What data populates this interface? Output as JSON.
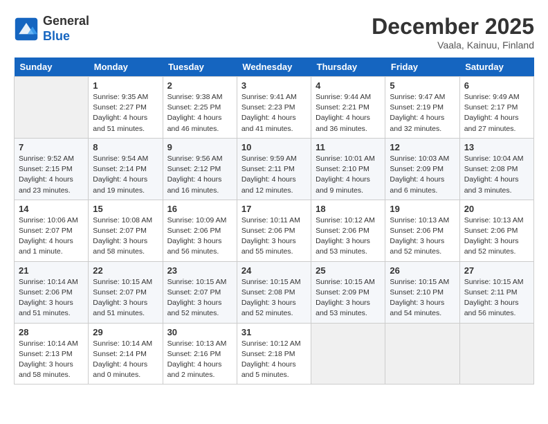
{
  "header": {
    "logo_general": "General",
    "logo_blue": "Blue",
    "month_year": "December 2025",
    "location": "Vaala, Kainuu, Finland"
  },
  "days_of_week": [
    "Sunday",
    "Monday",
    "Tuesday",
    "Wednesday",
    "Thursday",
    "Friday",
    "Saturday"
  ],
  "weeks": [
    [
      {
        "day": "",
        "info": ""
      },
      {
        "day": "1",
        "info": "Sunrise: 9:35 AM\nSunset: 2:27 PM\nDaylight: 4 hours\nand 51 minutes."
      },
      {
        "day": "2",
        "info": "Sunrise: 9:38 AM\nSunset: 2:25 PM\nDaylight: 4 hours\nand 46 minutes."
      },
      {
        "day": "3",
        "info": "Sunrise: 9:41 AM\nSunset: 2:23 PM\nDaylight: 4 hours\nand 41 minutes."
      },
      {
        "day": "4",
        "info": "Sunrise: 9:44 AM\nSunset: 2:21 PM\nDaylight: 4 hours\nand 36 minutes."
      },
      {
        "day": "5",
        "info": "Sunrise: 9:47 AM\nSunset: 2:19 PM\nDaylight: 4 hours\nand 32 minutes."
      },
      {
        "day": "6",
        "info": "Sunrise: 9:49 AM\nSunset: 2:17 PM\nDaylight: 4 hours\nand 27 minutes."
      }
    ],
    [
      {
        "day": "7",
        "info": "Sunrise: 9:52 AM\nSunset: 2:15 PM\nDaylight: 4 hours\nand 23 minutes."
      },
      {
        "day": "8",
        "info": "Sunrise: 9:54 AM\nSunset: 2:14 PM\nDaylight: 4 hours\nand 19 minutes."
      },
      {
        "day": "9",
        "info": "Sunrise: 9:56 AM\nSunset: 2:12 PM\nDaylight: 4 hours\nand 16 minutes."
      },
      {
        "day": "10",
        "info": "Sunrise: 9:59 AM\nSunset: 2:11 PM\nDaylight: 4 hours\nand 12 minutes."
      },
      {
        "day": "11",
        "info": "Sunrise: 10:01 AM\nSunset: 2:10 PM\nDaylight: 4 hours\nand 9 minutes."
      },
      {
        "day": "12",
        "info": "Sunrise: 10:03 AM\nSunset: 2:09 PM\nDaylight: 4 hours\nand 6 minutes."
      },
      {
        "day": "13",
        "info": "Sunrise: 10:04 AM\nSunset: 2:08 PM\nDaylight: 4 hours\nand 3 minutes."
      }
    ],
    [
      {
        "day": "14",
        "info": "Sunrise: 10:06 AM\nSunset: 2:07 PM\nDaylight: 4 hours\nand 1 minute."
      },
      {
        "day": "15",
        "info": "Sunrise: 10:08 AM\nSunset: 2:07 PM\nDaylight: 3 hours\nand 58 minutes."
      },
      {
        "day": "16",
        "info": "Sunrise: 10:09 AM\nSunset: 2:06 PM\nDaylight: 3 hours\nand 56 minutes."
      },
      {
        "day": "17",
        "info": "Sunrise: 10:11 AM\nSunset: 2:06 PM\nDaylight: 3 hours\nand 55 minutes."
      },
      {
        "day": "18",
        "info": "Sunrise: 10:12 AM\nSunset: 2:06 PM\nDaylight: 3 hours\nand 53 minutes."
      },
      {
        "day": "19",
        "info": "Sunrise: 10:13 AM\nSunset: 2:06 PM\nDaylight: 3 hours\nand 52 minutes."
      },
      {
        "day": "20",
        "info": "Sunrise: 10:13 AM\nSunset: 2:06 PM\nDaylight: 3 hours\nand 52 minutes."
      }
    ],
    [
      {
        "day": "21",
        "info": "Sunrise: 10:14 AM\nSunset: 2:06 PM\nDaylight: 3 hours\nand 51 minutes."
      },
      {
        "day": "22",
        "info": "Sunrise: 10:15 AM\nSunset: 2:07 PM\nDaylight: 3 hours\nand 51 minutes."
      },
      {
        "day": "23",
        "info": "Sunrise: 10:15 AM\nSunset: 2:07 PM\nDaylight: 3 hours\nand 52 minutes."
      },
      {
        "day": "24",
        "info": "Sunrise: 10:15 AM\nSunset: 2:08 PM\nDaylight: 3 hours\nand 52 minutes."
      },
      {
        "day": "25",
        "info": "Sunrise: 10:15 AM\nSunset: 2:09 PM\nDaylight: 3 hours\nand 53 minutes."
      },
      {
        "day": "26",
        "info": "Sunrise: 10:15 AM\nSunset: 2:10 PM\nDaylight: 3 hours\nand 54 minutes."
      },
      {
        "day": "27",
        "info": "Sunrise: 10:15 AM\nSunset: 2:11 PM\nDaylight: 3 hours\nand 56 minutes."
      }
    ],
    [
      {
        "day": "28",
        "info": "Sunrise: 10:14 AM\nSunset: 2:13 PM\nDaylight: 3 hours\nand 58 minutes."
      },
      {
        "day": "29",
        "info": "Sunrise: 10:14 AM\nSunset: 2:14 PM\nDaylight: 4 hours\nand 0 minutes."
      },
      {
        "day": "30",
        "info": "Sunrise: 10:13 AM\nSunset: 2:16 PM\nDaylight: 4 hours\nand 2 minutes."
      },
      {
        "day": "31",
        "info": "Sunrise: 10:12 AM\nSunset: 2:18 PM\nDaylight: 4 hours\nand 5 minutes."
      },
      {
        "day": "",
        "info": ""
      },
      {
        "day": "",
        "info": ""
      },
      {
        "day": "",
        "info": ""
      }
    ]
  ]
}
